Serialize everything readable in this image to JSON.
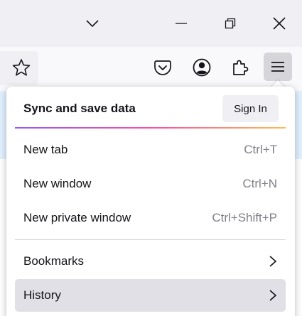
{
  "window": {
    "icons": [
      "chevron-down-icon",
      "minimize-icon",
      "restore-icon",
      "close-icon"
    ]
  },
  "toolbar": {
    "icons": [
      "star-icon",
      "pocket-icon",
      "account-icon",
      "extensions-icon",
      "hamburger-menu-icon"
    ]
  },
  "menu": {
    "sync": {
      "title": "Sync and save data",
      "sign_in_label": "Sign In"
    },
    "items": [
      {
        "label": "New tab",
        "shortcut": "Ctrl+T"
      },
      {
        "label": "New window",
        "shortcut": "Ctrl+N"
      },
      {
        "label": "New private window",
        "shortcut": "Ctrl+Shift+P"
      },
      {
        "label": "Bookmarks"
      },
      {
        "label": "History"
      }
    ]
  },
  "colors": {
    "accent_gradient": [
      "#9059ff",
      "#ff4aa2",
      "#ffbd4f"
    ],
    "hover": "#e0e0e6",
    "shortcut_text": "#80808a"
  }
}
